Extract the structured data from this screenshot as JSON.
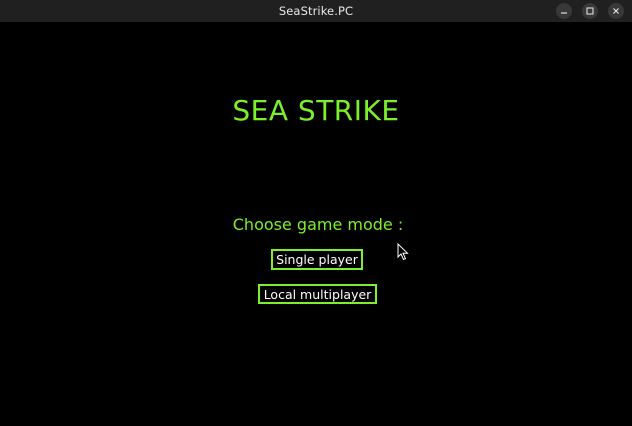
{
  "window": {
    "title": "SeaStrike.PC",
    "controls": [
      "minimize-icon",
      "maximize-icon",
      "close-icon"
    ]
  },
  "game": {
    "title": "SEA STRIKE",
    "prompt": "Choose game mode :",
    "modes": [
      {
        "label": "Single player"
      },
      {
        "label": "Local multiplayer"
      }
    ]
  },
  "colors": {
    "background": "#000000",
    "accent": "#7cf02b",
    "button_text": "#ffffff",
    "titlebar": "#202020"
  }
}
